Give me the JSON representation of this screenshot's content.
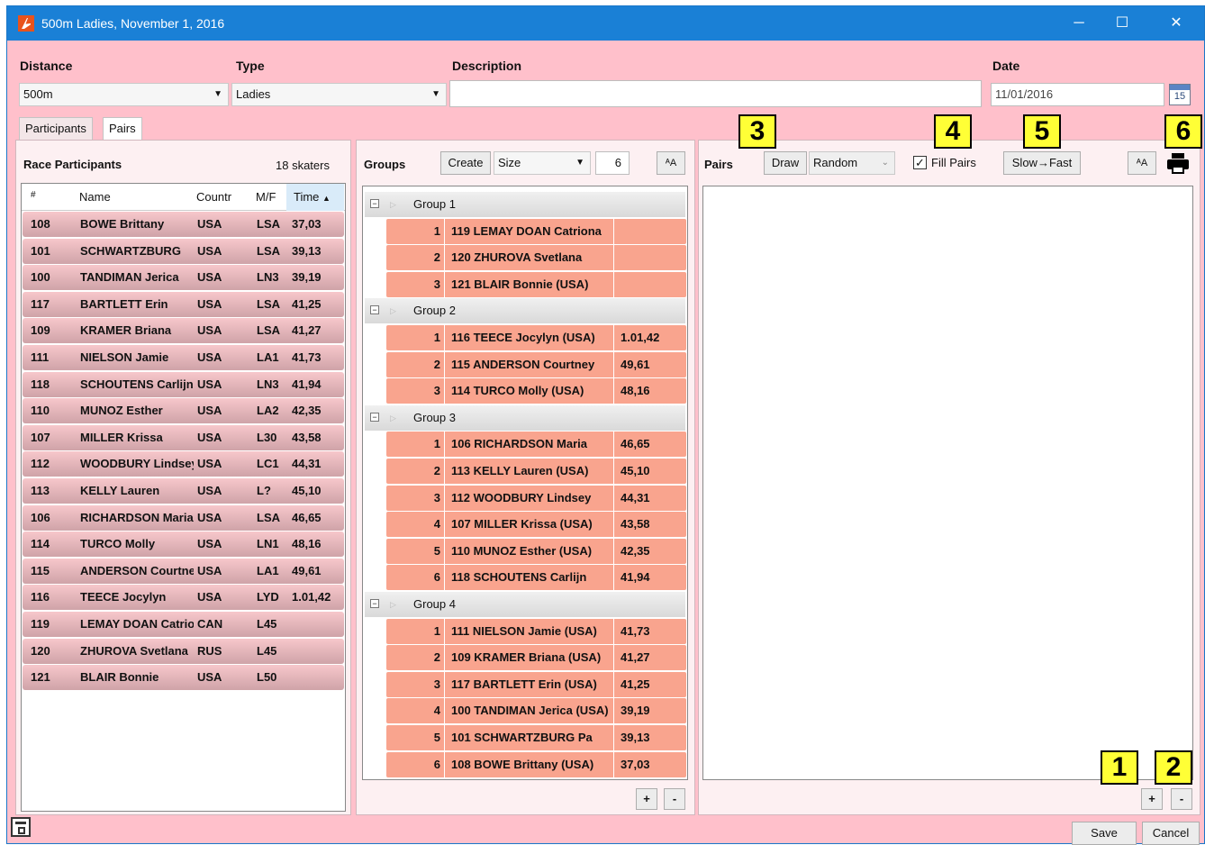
{
  "window": {
    "title": "500m Ladies, November 1, 2016",
    "minimize": "─",
    "maximize": "☐",
    "close": "✕"
  },
  "form": {
    "distance_label": "Distance",
    "distance_value": "500m",
    "type_label": "Type",
    "type_value": "Ladies",
    "description_label": "Description",
    "description_value": "",
    "date_label": "Date",
    "date_value": "11/01/2016",
    "calendar_day": "15"
  },
  "tabs": [
    "Participants",
    "Pairs"
  ],
  "participants": {
    "title": "Race Participants",
    "count": "18 skaters",
    "columns": [
      "#",
      "Name",
      "Countr",
      "M/F",
      "Time"
    ],
    "sort_indicator": "▲",
    "rows": [
      [
        "108",
        "BOWE Brittany",
        "USA",
        "LSA",
        "37,03"
      ],
      [
        "101",
        "SCHWARTZBURG",
        "USA",
        "LSA",
        "39,13"
      ],
      [
        "100",
        "TANDIMAN Jerica",
        "USA",
        "LN3",
        "39,19"
      ],
      [
        "117",
        "BARTLETT Erin",
        "USA",
        "LSA",
        "41,25"
      ],
      [
        "109",
        "KRAMER Briana",
        "USA",
        "LSA",
        "41,27"
      ],
      [
        "111",
        "NIELSON Jamie",
        "USA",
        "LA1",
        "41,73"
      ],
      [
        "118",
        "SCHOUTENS Carlijn",
        "USA",
        "LN3",
        "41,94"
      ],
      [
        "110",
        "MUNOZ Esther",
        "USA",
        "LA2",
        "42,35"
      ],
      [
        "107",
        "MILLER Krissa",
        "USA",
        "L30",
        "43,58"
      ],
      [
        "112",
        "WOODBURY Lindsey",
        "USA",
        "LC1",
        "44,31"
      ],
      [
        "113",
        "KELLY Lauren",
        "USA",
        "L?",
        "45,10"
      ],
      [
        "106",
        "RICHARDSON Maria",
        "USA",
        "LSA",
        "46,65"
      ],
      [
        "114",
        "TURCO Molly",
        "USA",
        "LN1",
        "48,16"
      ],
      [
        "115",
        "ANDERSON Courtney",
        "USA",
        "LA1",
        "49,61"
      ],
      [
        "116",
        "TEECE Jocylyn",
        "USA",
        "LYD",
        "1.01,42"
      ],
      [
        "119",
        "LEMAY DOAN Catriona",
        "CAN",
        "L45",
        ""
      ],
      [
        "120",
        "ZHUROVA Svetlana",
        "RUS",
        "L45",
        ""
      ],
      [
        "121",
        "BLAIR Bonnie",
        "USA",
        "L50",
        ""
      ]
    ]
  },
  "groups": {
    "title": "Groups",
    "create_label": "Create",
    "size_option": "Size",
    "size_value": "6",
    "font_btn": "ᴬA",
    "add_btn": "+",
    "remove_btn": "-",
    "list": [
      {
        "name": "Group 1",
        "items": [
          [
            "1",
            "119 LEMAY DOAN Catriona",
            ""
          ],
          [
            "2",
            "120 ZHUROVA Svetlana",
            ""
          ],
          [
            "3",
            "121 BLAIR Bonnie (USA)",
            ""
          ]
        ]
      },
      {
        "name": "Group 2",
        "items": [
          [
            "1",
            "116 TEECE Jocylyn (USA)",
            "1.01,42"
          ],
          [
            "2",
            "115 ANDERSON Courtney",
            "49,61"
          ],
          [
            "3",
            "114 TURCO Molly (USA)",
            "48,16"
          ]
        ]
      },
      {
        "name": "Group 3",
        "items": [
          [
            "1",
            "106 RICHARDSON Maria",
            "46,65"
          ],
          [
            "2",
            "113 KELLY Lauren (USA)",
            "45,10"
          ],
          [
            "3",
            "112 WOODBURY Lindsey",
            "44,31"
          ],
          [
            "4",
            "107 MILLER Krissa (USA)",
            "43,58"
          ],
          [
            "5",
            "110 MUNOZ Esther (USA)",
            "42,35"
          ],
          [
            "6",
            "118 SCHOUTENS Carlijn",
            "41,94"
          ]
        ]
      },
      {
        "name": "Group 4",
        "items": [
          [
            "1",
            "111 NIELSON Jamie (USA)",
            "41,73"
          ],
          [
            "2",
            "109 KRAMER Briana (USA)",
            "41,27"
          ],
          [
            "3",
            "117 BARTLETT Erin (USA)",
            "41,25"
          ],
          [
            "4",
            "100 TANDIMAN Jerica (USA)",
            "39,19"
          ],
          [
            "5",
            "101 SCHWARTZBURG Pa",
            "39,13"
          ],
          [
            "6",
            "108 BOWE Brittany (USA)",
            "37,03"
          ]
        ]
      }
    ]
  },
  "pairs": {
    "title": "Pairs",
    "draw_label": "Draw",
    "draw_mode": "Random",
    "fill_pairs_label": "Fill Pairs",
    "fill_pairs_checked": true,
    "order_label": "Slow→Fast",
    "font_btn": "ᴬA",
    "add_btn": "+",
    "remove_btn": "-"
  },
  "annotations": [
    "1",
    "2",
    "3",
    "4",
    "5",
    "6"
  ],
  "footer": {
    "save_label": "Save",
    "cancel_label": "Cancel"
  },
  "colors": {
    "window_bg": "#ffc0cb",
    "titlebar": "#1a80d6",
    "group_item": "#f9a48e",
    "badge": "#ffff36"
  }
}
